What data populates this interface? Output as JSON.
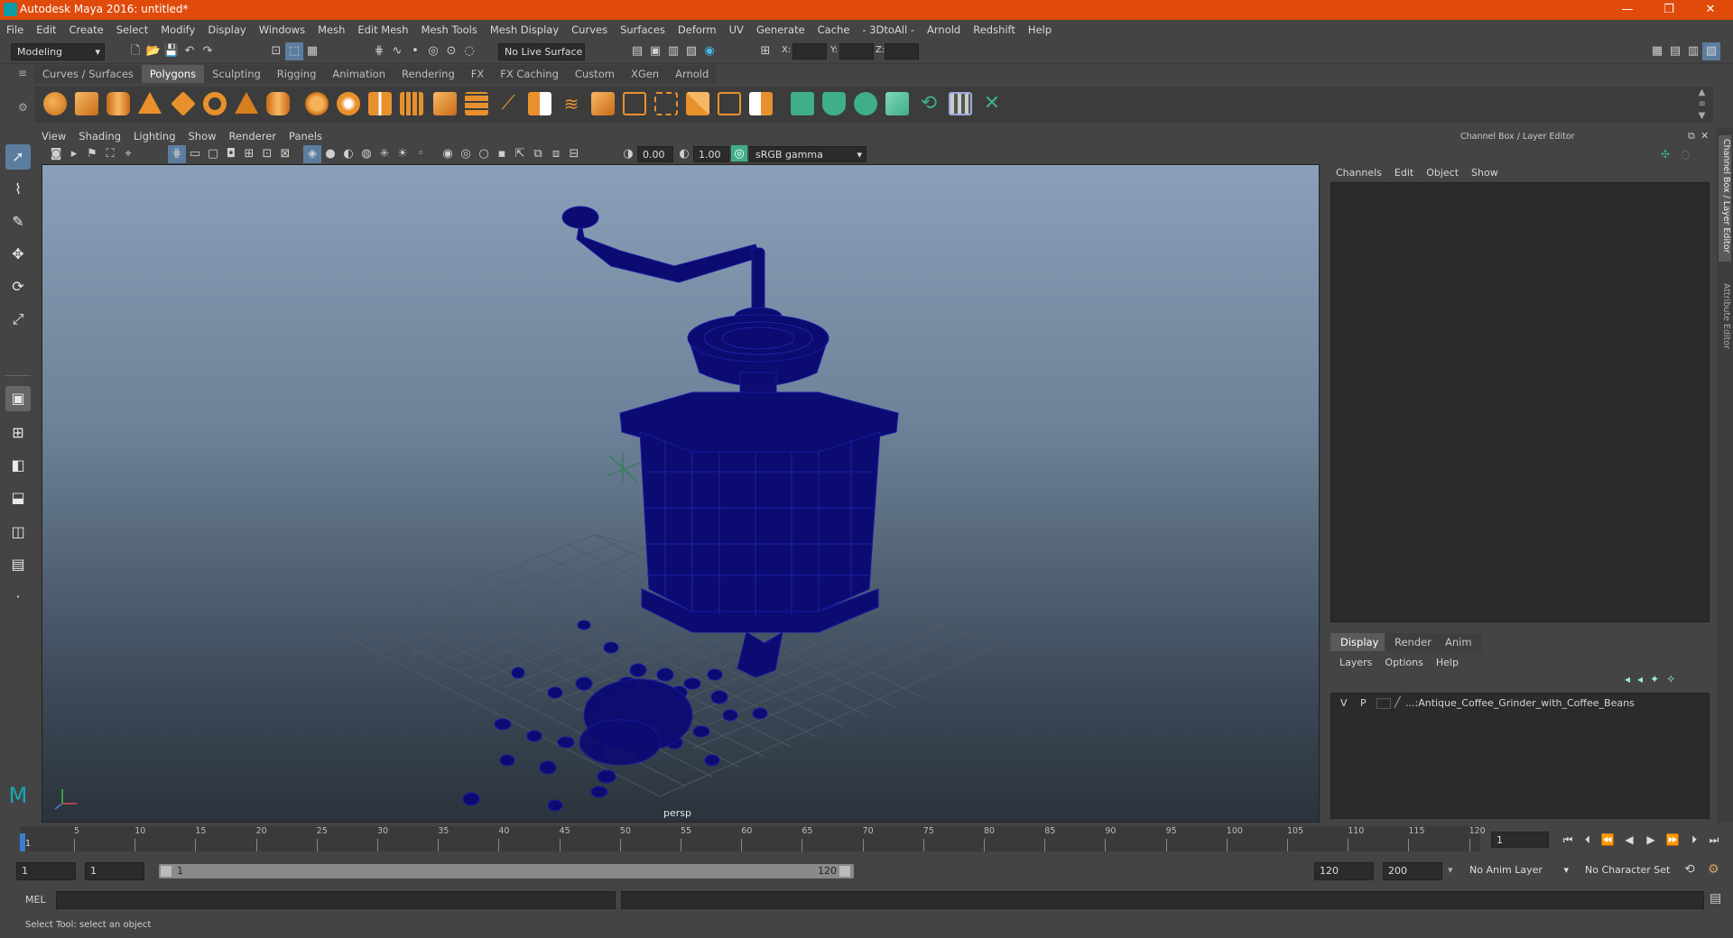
{
  "window": {
    "title": "Autodesk Maya 2016: untitled*",
    "minimize_label": "—",
    "restore_label": "❐",
    "close_label": "✕"
  },
  "menubar": {
    "items": [
      "File",
      "Edit",
      "Create",
      "Select",
      "Modify",
      "Display",
      "Windows",
      "Mesh",
      "Edit Mesh",
      "Mesh Tools",
      "Mesh Display",
      "Curves",
      "Surfaces",
      "Deform",
      "UV",
      "Generate",
      "Cache",
      "- 3DtoAll -",
      "Arnold",
      "Redshift",
      "Help"
    ]
  },
  "statusline": {
    "mode": "Modeling",
    "live_surface": "No Live Surface",
    "x_label": "X:",
    "y_label": "Y:",
    "z_label": "Z:"
  },
  "shelf": {
    "tabs": [
      "Curves / Surfaces",
      "Polygons",
      "Sculpting",
      "Rigging",
      "Animation",
      "Rendering",
      "FX",
      "FX Caching",
      "Custom",
      "XGen",
      "Arnold"
    ],
    "active_tab": "Polygons",
    "accent_orange": "#e8912c",
    "accent_green": "#3fae8a"
  },
  "panel": {
    "menu": [
      "View",
      "Shading",
      "Lighting",
      "Show",
      "Renderer",
      "Panels"
    ],
    "exposure": "0.00",
    "gamma": "1.00",
    "color_space": "sRGB gamma",
    "camera_label": "persp",
    "wireframe_color": "#0d0d7a"
  },
  "channel_box": {
    "header": "Channel Box / Layer Editor",
    "menu": [
      "Channels",
      "Edit",
      "Object",
      "Show"
    ]
  },
  "layer_editor": {
    "tabs": [
      "Display",
      "Render",
      "Anim"
    ],
    "active_tab": "Display",
    "menu": [
      "Layers",
      "Options",
      "Help"
    ],
    "layer": {
      "visible": "V",
      "playback": "P",
      "name": "...:Antique_Coffee_Grinder_with_Coffee_Beans"
    }
  },
  "side_tabs": {
    "channel_box": "Channel Box / Layer Editor",
    "attribute_editor": "Attribute Editor"
  },
  "timeline": {
    "ticks": [
      "5",
      "10",
      "15",
      "20",
      "25",
      "30",
      "35",
      "40",
      "45",
      "50",
      "55",
      "60",
      "65",
      "70",
      "75",
      "80",
      "85",
      "90",
      "95",
      "100",
      "105",
      "110",
      "115",
      "120"
    ],
    "start_marker": "1",
    "current_frame": "1"
  },
  "range": {
    "start": "1",
    "playback_start": "1",
    "slider_start": "1",
    "slider_end": "120",
    "playback_end": "120",
    "end": "200",
    "anim_layer": "No Anim Layer",
    "character_set": "No Character Set"
  },
  "command": {
    "language": "MEL"
  },
  "help": {
    "text": "Select Tool: select an object"
  }
}
